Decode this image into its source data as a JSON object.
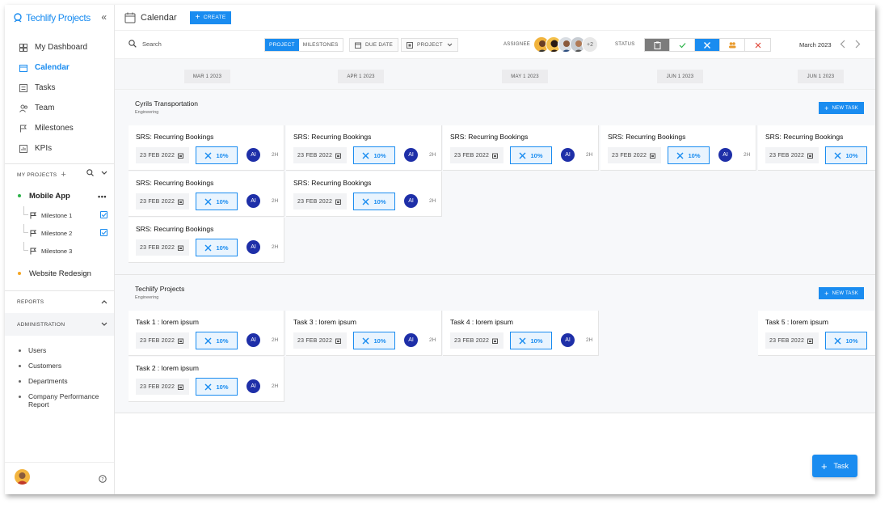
{
  "app": {
    "name": "Techlify Projects",
    "accent": "#1a8cf0"
  },
  "nav": [
    {
      "label": "My Dashboard",
      "icon": "dashboard-icon"
    },
    {
      "label": "Calendar",
      "icon": "calendar-icon",
      "active": true
    },
    {
      "label": "Tasks",
      "icon": "tasks-icon"
    },
    {
      "label": "Team",
      "icon": "team-icon"
    },
    {
      "label": "Milestones",
      "icon": "flag-icon"
    },
    {
      "label": "KPIs",
      "icon": "kpi-icon"
    }
  ],
  "my_projects": {
    "header": "MY PROJECTS",
    "projects": [
      {
        "name": "Mobile App",
        "dot": "#2db34a"
      },
      {
        "name": "Website Redesign",
        "dot": "#f5a623"
      }
    ],
    "milestones": [
      "Milestone 1",
      "Milestone 2",
      "Milestone 3"
    ]
  },
  "reports_header": "REPORTS",
  "admin": {
    "header": "ADMINISTRATION",
    "items": [
      "Users",
      "Customers",
      "Departments",
      "Company Performance Report"
    ]
  },
  "topbar": {
    "title": "Calendar",
    "create": "CREATE"
  },
  "toolbar": {
    "search_placeholder": "Search",
    "seg": [
      "PROJECT",
      "MILESTONES"
    ],
    "due_date": "DUE DATE",
    "project_filter": "PROJECT",
    "assignee": "ASSIGNEE",
    "more_assignees": "+2",
    "status": "STATUS",
    "month": "March 2023"
  },
  "timeline": [
    "MAR 1 2023",
    "APR 1 2023",
    "MAY 1 2023",
    "JUN 1 2023",
    "JUN 1 2023"
  ],
  "groups": [
    {
      "title": "Cyrils Transportation",
      "subtitle": "Engineering",
      "new_task": "NEW TASK",
      "cards": [
        {
          "title": "SRS: Recurring Bookings",
          "date": "23 FEB 2022",
          "progress": "10%",
          "assignee": "AI",
          "hours": "2H"
        },
        {
          "title": "SRS: Recurring Bookings",
          "date": "23 FEB 2022",
          "progress": "10%",
          "assignee": "AI",
          "hours": "2H"
        },
        {
          "title": "SRS: Recurring Bookings",
          "date": "23 FEB 2022",
          "progress": "10%",
          "assignee": "AI",
          "hours": "2H"
        },
        {
          "title": "SRS: Recurring Bookings",
          "date": "23 FEB 2022",
          "progress": "10%",
          "assignee": "AI",
          "hours": "2H"
        },
        {
          "title": "SRS: Recurring Bookings",
          "date": "23 FEB 2022",
          "progress": "10%",
          "assignee": "",
          "hours": ""
        },
        {
          "title": "SRS: Recurring Bookings",
          "date": "23 FEB 2022",
          "progress": "10%",
          "assignee": "AI",
          "hours": "2H"
        },
        {
          "title": "SRS: Recurring Bookings",
          "date": "23 FEB 2022",
          "progress": "10%",
          "assignee": "AI",
          "hours": "2H"
        },
        {
          "title": "SRS: Recurring Bookings",
          "date": "23 FEB 2022",
          "progress": "10%",
          "assignee": "AI",
          "hours": "2H"
        }
      ]
    },
    {
      "title": "Techlify Projects",
      "subtitle": "Engineering",
      "new_task": "NEW TASK",
      "cards": [
        {
          "title": "Task 1 : lorem ipsum",
          "date": "23 FEB 2022",
          "progress": "10%",
          "assignee": "AI",
          "hours": "2H"
        },
        {
          "title": "Task 3 : lorem ipsum",
          "date": "23 FEB 2022",
          "progress": "10%",
          "assignee": "AI",
          "hours": "2H"
        },
        {
          "title": "Task 4 : lorem ipsum",
          "date": "23 FEB 2022",
          "progress": "10%",
          "assignee": "AI",
          "hours": "2H"
        },
        {
          "title": "Task 5 : lorem ipsum",
          "date": "23 FEB 2022",
          "progress": "10%",
          "assignee": "",
          "hours": ""
        },
        {
          "title": "Task 2 : lorem ipsum",
          "date": "23 FEB 2022",
          "progress": "10%",
          "assignee": "AI",
          "hours": "2H"
        }
      ]
    }
  ],
  "fab": "Task"
}
